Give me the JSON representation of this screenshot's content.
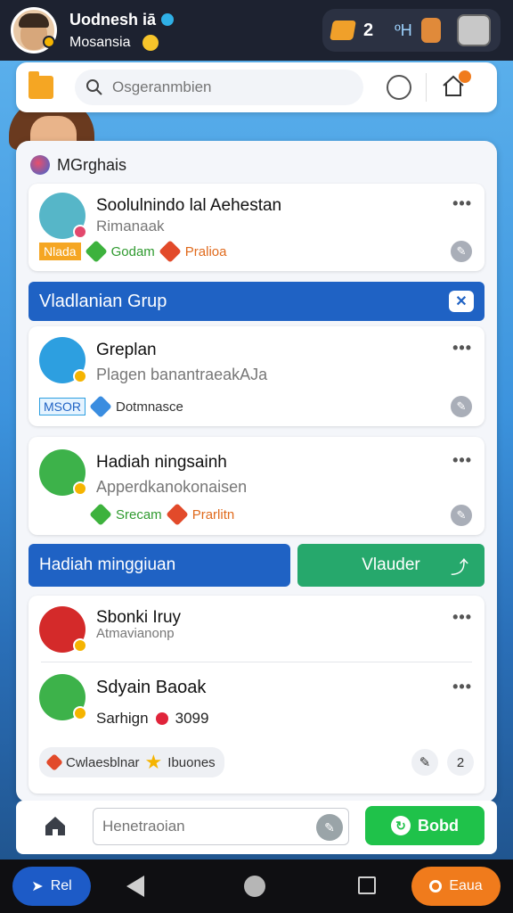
{
  "topbar": {
    "user_name": "Uodnesh iā",
    "user_sub": "Mosansia",
    "count": "2",
    "key_label": "ºH"
  },
  "search": {
    "placeholder": "Osgeranmbien"
  },
  "panel": {
    "title": "MGrghais"
  },
  "cards": {
    "c1": {
      "title": "Soolulnindo lal Aehestan",
      "sub": "Rimanaak",
      "tag": "Nlada",
      "chip1": "Godam",
      "chip2": "Pralioa"
    },
    "header": {
      "label": "Vladlanian Grup",
      "close": "✕"
    },
    "c2": {
      "title": "Greplan",
      "sub": "Plagen banantraeakAJa",
      "tag": "MSOR",
      "chip1": "Dotmnasce"
    },
    "c3": {
      "title": "Hadiah ningsainh",
      "sub": "Apperdkanokonaisen",
      "chip1": "Srecam",
      "chip2": "Prarlitn"
    },
    "actions": {
      "left": "Hadiah minggiuan",
      "right": "Vlauder"
    },
    "c4": {
      "title": "Sbonki Iruy",
      "sub": "Atmavianonp"
    },
    "c5": {
      "title": "Sdyain Baoak",
      "sub": "Sarhign",
      "value": "3099",
      "chip1": "Cwlaesblnar",
      "chip2": "Ibuones",
      "count": "2"
    }
  },
  "bottom": {
    "placeholder": "Henetraoian",
    "send": "Bobd"
  },
  "nav": {
    "left": "Rel",
    "right": "Eaua"
  },
  "colors": {
    "primary_blue": "#1f62c4",
    "green": "#26a86c",
    "send_green": "#1fc24a",
    "orange": "#f07b1c"
  }
}
